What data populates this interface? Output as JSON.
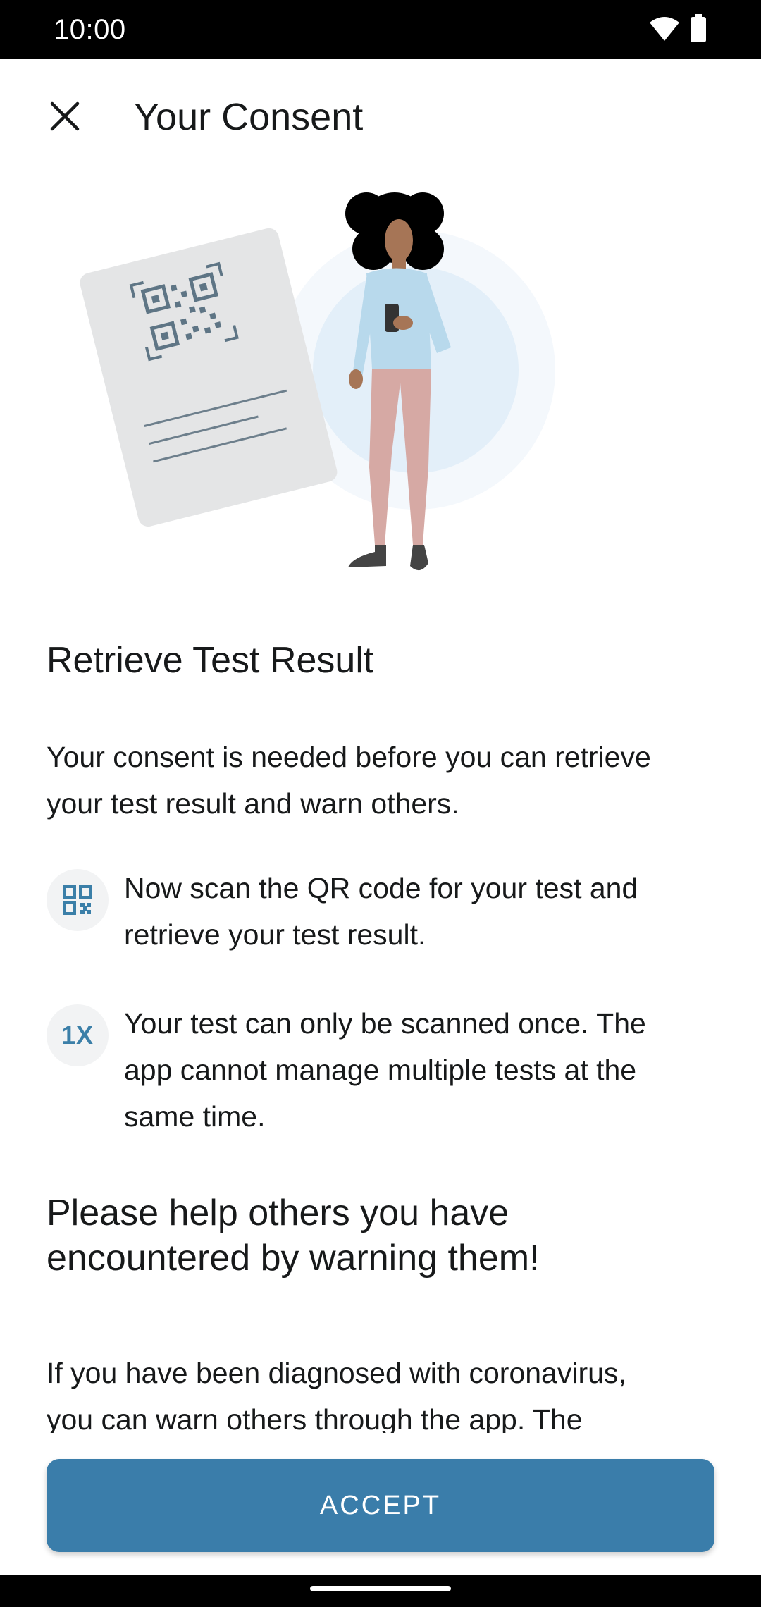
{
  "status_bar": {
    "time": "10:00"
  },
  "app_bar": {
    "title": "Your Consent"
  },
  "section1": {
    "heading": "Retrieve Test Result",
    "intro_line1": "Your consent is needed before you can retrieve",
    "intro_line2": "your test result and warn others.",
    "bullets": [
      {
        "icon": "qr-code-icon",
        "line1": "Now scan the QR code for your test and",
        "line2": "retrieve your test result."
      },
      {
        "icon": "1x-icon",
        "badge_text": "1X",
        "line1": "Your test can only be scanned once. The",
        "line2": "app cannot manage multiple tests at the",
        "line3": "same time."
      }
    ]
  },
  "section2": {
    "heading_line1": "Please help others you have",
    "heading_line2": "encountered by warning them!",
    "para_line1": "If you have been diagnosed with coronavirus,",
    "para_line2": "you can warn others through the app. The"
  },
  "actions": {
    "accept_label": "ACCEPT"
  },
  "colors": {
    "accent": "#3a7daa",
    "badge_bg": "#f2f3f4",
    "text": "#17191a"
  }
}
